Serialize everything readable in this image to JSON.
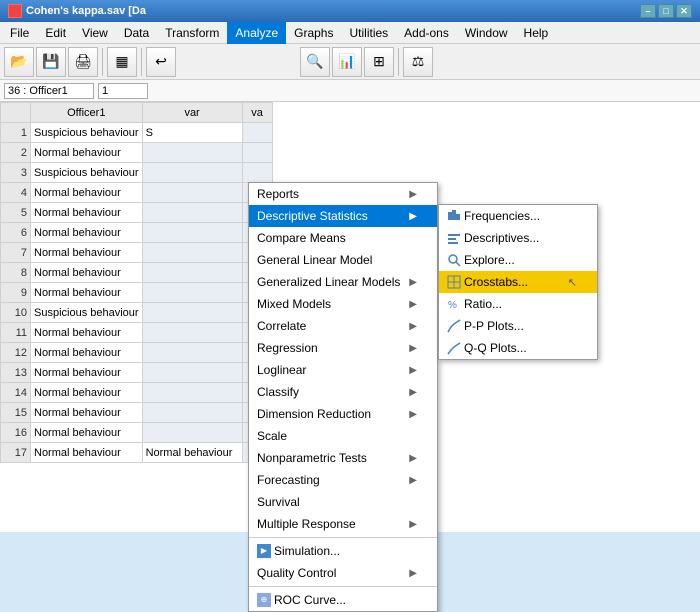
{
  "titlebar": {
    "title": "Cohen's kappa.sav [Da",
    "icon": "spss-icon"
  },
  "menubar": {
    "items": [
      "File",
      "Edit",
      "View",
      "Data",
      "Transform",
      "Analyze",
      "Graphs",
      "Utilities",
      "Add-ons",
      "Window",
      "Help"
    ]
  },
  "cellbar": {
    "ref": "36 : Officer1",
    "val": "1"
  },
  "columns": {
    "header": [
      "Officer1",
      "var",
      "va"
    ]
  },
  "rows": [
    {
      "num": 1,
      "col1": "Suspicious behaviour",
      "col2": "S"
    },
    {
      "num": 2,
      "col1": "Normal behaviour",
      "col2": ""
    },
    {
      "num": 3,
      "col1": "Suspicious behaviour",
      "col2": ""
    },
    {
      "num": 4,
      "col1": "Normal behaviour",
      "col2": ""
    },
    {
      "num": 5,
      "col1": "Normal behaviour",
      "col2": ""
    },
    {
      "num": 6,
      "col1": "Normal behaviour",
      "col2": ""
    },
    {
      "num": 7,
      "col1": "Normal behaviour",
      "col2": ""
    },
    {
      "num": 8,
      "col1": "Normal behaviour",
      "col2": ""
    },
    {
      "num": 9,
      "col1": "Normal behaviour",
      "col2": ""
    },
    {
      "num": 10,
      "col1": "Suspicious behaviour",
      "col2": ""
    },
    {
      "num": 11,
      "col1": "Normal behaviour",
      "col2": ""
    },
    {
      "num": 12,
      "col1": "Normal behaviour",
      "col2": ""
    },
    {
      "num": 13,
      "col1": "Normal behaviour",
      "col2": ""
    },
    {
      "num": 14,
      "col1": "Normal behaviour",
      "col2": ""
    },
    {
      "num": 15,
      "col1": "Normal behaviour",
      "col2": ""
    },
    {
      "num": 16,
      "col1": "Normal behaviour",
      "col2": ""
    },
    {
      "num": 17,
      "col1": "Normal behaviour",
      "col2": "Normal behaviour"
    }
  ],
  "analyze_menu": {
    "items": [
      {
        "label": "Reports",
        "arrow": true
      },
      {
        "label": "Descriptive Statistics",
        "arrow": true,
        "active": true
      },
      {
        "label": "Compare Means",
        "arrow": false
      },
      {
        "label": "General Linear Model",
        "arrow": false
      },
      {
        "label": "Generalized Linear Models",
        "arrow": true
      },
      {
        "label": "Mixed Models",
        "arrow": true
      },
      {
        "label": "Correlate",
        "arrow": true
      },
      {
        "label": "Regression",
        "arrow": true
      },
      {
        "label": "Loglinear",
        "arrow": true
      },
      {
        "label": "Classify",
        "arrow": true
      },
      {
        "label": "Dimension Reduction",
        "arrow": true
      },
      {
        "label": "Scale",
        "arrow": false
      },
      {
        "label": "Nonparametric Tests",
        "arrow": true
      },
      {
        "label": "Forecasting",
        "arrow": true
      },
      {
        "label": "Survival",
        "arrow": false
      },
      {
        "label": "Multiple Response",
        "arrow": true
      },
      {
        "label": "Simulation...",
        "icon": true
      },
      {
        "label": "Quality Control",
        "arrow": true
      },
      {
        "label": "ROC Curve...",
        "icon": true
      }
    ]
  },
  "descriptive_submenu": {
    "items": [
      {
        "label": "Frequencies...",
        "icon": "freq-icon"
      },
      {
        "label": "Descriptives...",
        "icon": "desc-icon"
      },
      {
        "label": "Explore...",
        "icon": "explore-icon"
      },
      {
        "label": "Crosstabs...",
        "icon": "crosstabs-icon",
        "highlighted": true
      },
      {
        "label": "Ratio...",
        "icon": "ratio-icon"
      },
      {
        "label": "P-P Plots...",
        "icon": "pp-icon"
      },
      {
        "label": "Q-Q Plots...",
        "icon": "qq-icon"
      }
    ]
  }
}
